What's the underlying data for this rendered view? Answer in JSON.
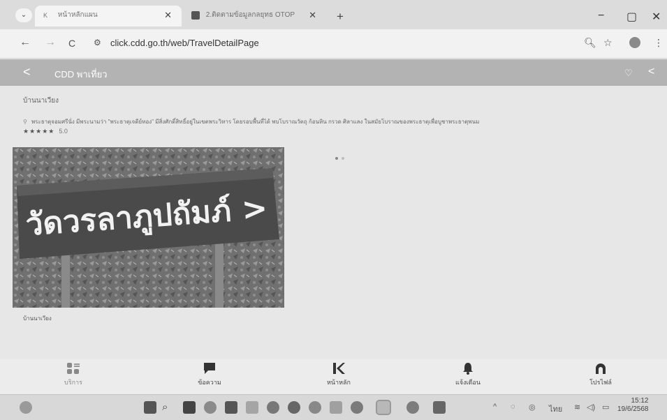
{
  "browser": {
    "tabs": [
      {
        "title": "หน้าหลักแผน",
        "active": true,
        "favicon": "K"
      },
      {
        "title": "2.ติดตามข้อมูลกลยุทธ OTOP",
        "active": false,
        "favicon": "sheet"
      }
    ],
    "tab_close": "✕",
    "new_tab": "+",
    "window_controls": {
      "minimize": "−",
      "maximize": "▢",
      "close": "✕"
    },
    "nav": {
      "back": "←",
      "forward": "→",
      "reload": "C"
    },
    "url": "click.cdd.go.th/web/TravelDetailPage"
  },
  "app_header": {
    "back": "<",
    "title": "CDD พาเที่ยว",
    "favorite": "♡",
    "share": "<"
  },
  "place": {
    "name": "บ้านนาเวียง",
    "description": "พระธาตุจอมศรีนั่ง มีพระนามว่า \"พระธาตุเจดีย์ทอง\" มีสิ่งศักดิ์สิทธิ์อยู่ในเขตพระวิหาร โดยรอบพื้นที่ได้ พบโบราณวัตถุ ก้อนหิน กรวด ศิลาแลง ในสมัยโบราณของพระธาตุเพื่อบูชาพระธาตุพนม",
    "stars": "★★★★★",
    "rating": "5.0",
    "photo_sign_text": "วัดวรลาภูปถัมภ์ >",
    "caption": "บ้านนาเวียง"
  },
  "bottom_nav": [
    {
      "label": "บริการ",
      "icon": "grid-icon"
    },
    {
      "label": "ข้อความ",
      "icon": "chat-icon"
    },
    {
      "label": "หน้าหลัก",
      "icon": "k-logo-icon"
    },
    {
      "label": "แจ้งเตือน",
      "icon": "bell-icon"
    },
    {
      "label": "โปรไฟล์",
      "icon": "profile-icon"
    }
  ],
  "taskbar": {
    "tray_lang": "ไทย",
    "time": "15:12",
    "date": "19/6/2568"
  }
}
